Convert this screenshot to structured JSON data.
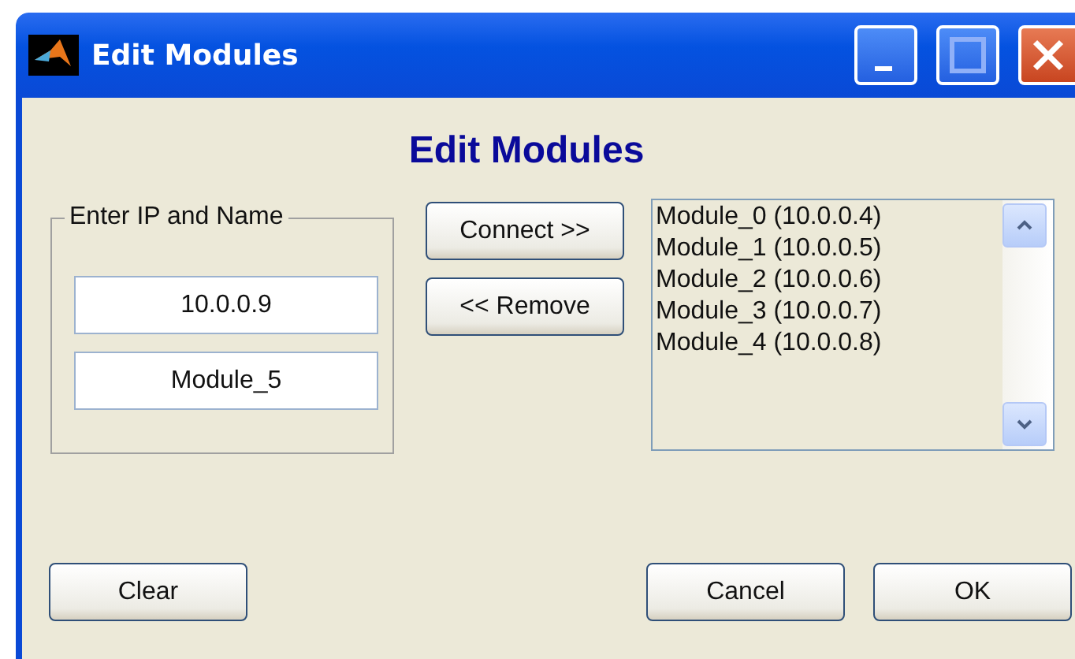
{
  "window": {
    "title": "Edit Modules"
  },
  "heading": "Edit Modules",
  "group": {
    "label": "Enter IP and Name",
    "fields": [
      {
        "value": "10.0.0.9"
      },
      {
        "value": "Module_5"
      }
    ]
  },
  "side_buttons": [
    "Connect >>",
    "<< Remove"
  ],
  "modules": [
    "Module_0 (10.0.0.4)",
    "Module_1 (10.0.0.5)",
    "Module_2 (10.0.0.6)",
    "Module_3 (10.0.0.7)",
    "Module_4 (10.0.0.8)"
  ],
  "footer": {
    "left": [
      "Clear"
    ],
    "right": [
      "Cancel",
      "OK"
    ]
  }
}
